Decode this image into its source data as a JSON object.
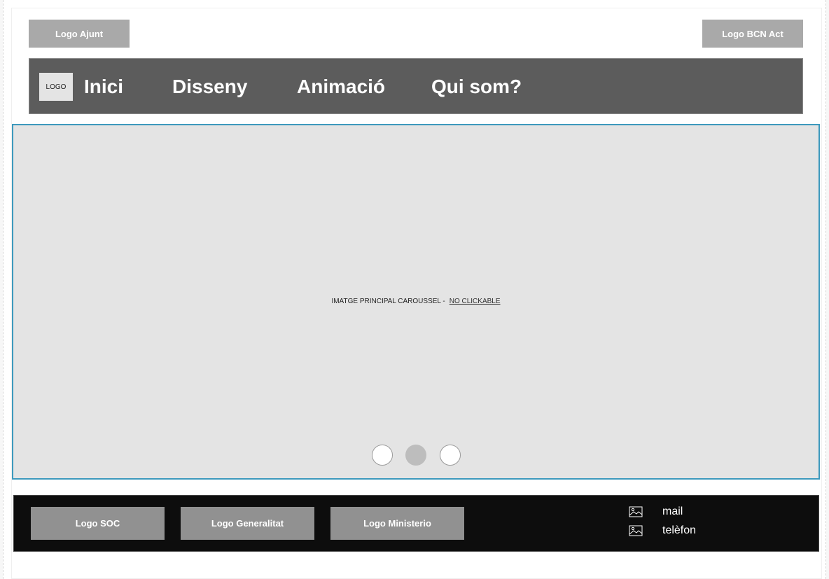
{
  "header": {
    "logo_left": "Logo Ajunt",
    "logo_right": "Logo BCN Act"
  },
  "nav": {
    "logo": "LOGO",
    "items": [
      "Inici",
      "Disseny",
      "Animació",
      "Qui som?"
    ]
  },
  "carousel": {
    "caption": "IMATGE PRINCIPAL CAROUSSEL -",
    "note": "NO CLICKABLE",
    "active_slide": 2,
    "slide_count": 3
  },
  "footer": {
    "logos": [
      "Logo SOC",
      "Logo Generalitat",
      "Logo Ministerio"
    ],
    "contact": {
      "mail": "mail",
      "phone": "telèfon"
    }
  },
  "colors": {
    "nav_bg": "#5c5c5c",
    "carousel_border": "#3d99bd",
    "footer_bg": "#0d0d0d"
  }
}
